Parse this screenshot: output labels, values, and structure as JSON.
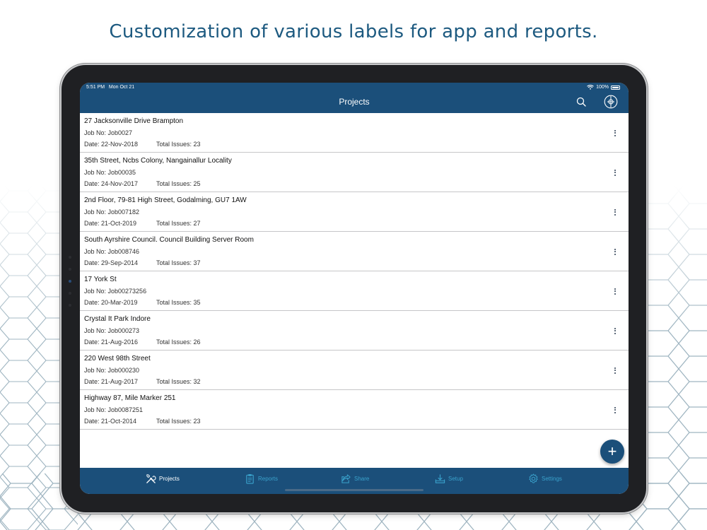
{
  "headline": "Customization of various labels for app and reports.",
  "status_bar": {
    "time": "5:51 PM",
    "date": "Mon Oct 21",
    "battery": "100%"
  },
  "nav": {
    "title": "Projects",
    "search_icon": "search-icon",
    "settings_icon": "gear-icon"
  },
  "projects": [
    {
      "name": "27 Jacksonville Drive Brampton",
      "job": "Job No: Job0027",
      "date": "Date: 22-Nov-2018",
      "issues": "Total Issues: 23"
    },
    {
      "name": "35th Street, Ncbs Colony, Nangainallur Locality",
      "job": "Job No: Job00035",
      "date": "Date: 24-Nov-2017",
      "issues": "Total Issues: 25"
    },
    {
      "name": "2nd Floor, 79-81 High Street, Godalming, GU7 1AW",
      "job": "Job No: Job007182",
      "date": "Date: 21-Oct-2019",
      "issues": "Total Issues: 27"
    },
    {
      "name": "South Ayrshire Council. Council Building Server Room",
      "job": "Job No: Job008746",
      "date": "Date: 29-Sep-2014",
      "issues": "Total Issues: 37"
    },
    {
      "name": "17 York St",
      "job": "Job No: Job00273256",
      "date": "Date: 20-Mar-2019",
      "issues": "Total Issues: 35"
    },
    {
      "name": "Crystal It Park Indore",
      "job": "Job No: Job000273",
      "date": "Date: 21-Aug-2016",
      "issues": "Total Issues: 26"
    },
    {
      "name": "220 West 98th Street",
      "job": "Job No: Job000230",
      "date": "Date: 21-Aug-2017",
      "issues": "Total Issues: 32"
    },
    {
      "name": "Highway 87, Mile Marker 251",
      "job": "Job No: Job0087251",
      "date": "Date: 21-Oct-2014",
      "issues": "Total Issues: 23"
    }
  ],
  "fab": {
    "label": "+",
    "icon": "plus-icon"
  },
  "tabs": [
    {
      "label": "Projects",
      "icon": "tools-icon",
      "active": true
    },
    {
      "label": "Reports",
      "icon": "clipboard-icon",
      "active": false
    },
    {
      "label": "Share",
      "icon": "share-icon",
      "active": false
    },
    {
      "label": "Setup",
      "icon": "download-tray-icon",
      "active": false
    },
    {
      "label": "Settings",
      "icon": "gear-icon",
      "active": false
    }
  ],
  "colors": {
    "primary": "#1b4f7a",
    "headline": "#1d5a80",
    "tab_active": "#ffffff",
    "tab_inactive": "#3aa2cc",
    "background_pattern": "#9fb5c1"
  }
}
